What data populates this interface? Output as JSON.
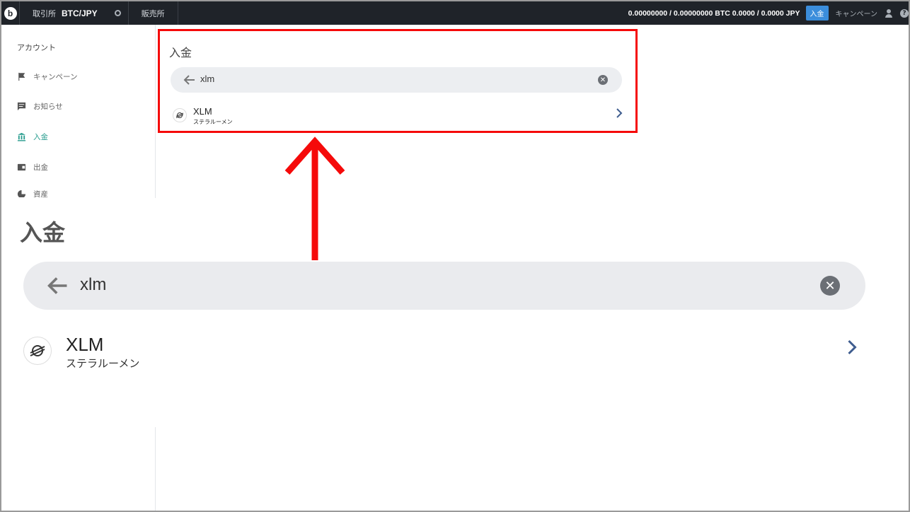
{
  "topbar": {
    "exchange_label": "取引所",
    "pair": "BTC/JPY",
    "sales_label": "販売所",
    "balance": "0.00000000 / 0.00000000 BTC   0.0000 / 0.0000 JPY",
    "deposit_button": "入金",
    "campaign_link": "キャンペーン"
  },
  "sidebar": {
    "heading": "アカウント",
    "items": [
      {
        "label": "キャンペーン",
        "icon": "flag-icon"
      },
      {
        "label": "お知らせ",
        "icon": "message-icon"
      },
      {
        "label": "入金",
        "icon": "bank-icon",
        "active": true
      },
      {
        "label": "出金",
        "icon": "wallet-icon"
      },
      {
        "label": "資産",
        "icon": "pie-chart-icon"
      }
    ]
  },
  "deposit_panel": {
    "title": "入金",
    "search_value": "xlm",
    "result": {
      "symbol": "XLM",
      "name": "ステラルーメン"
    }
  },
  "colors": {
    "accent": "#3b8ddb",
    "active": "#2a9d8f",
    "highlight_border": "#f50a0a",
    "chevron": "#3f5d8f"
  }
}
